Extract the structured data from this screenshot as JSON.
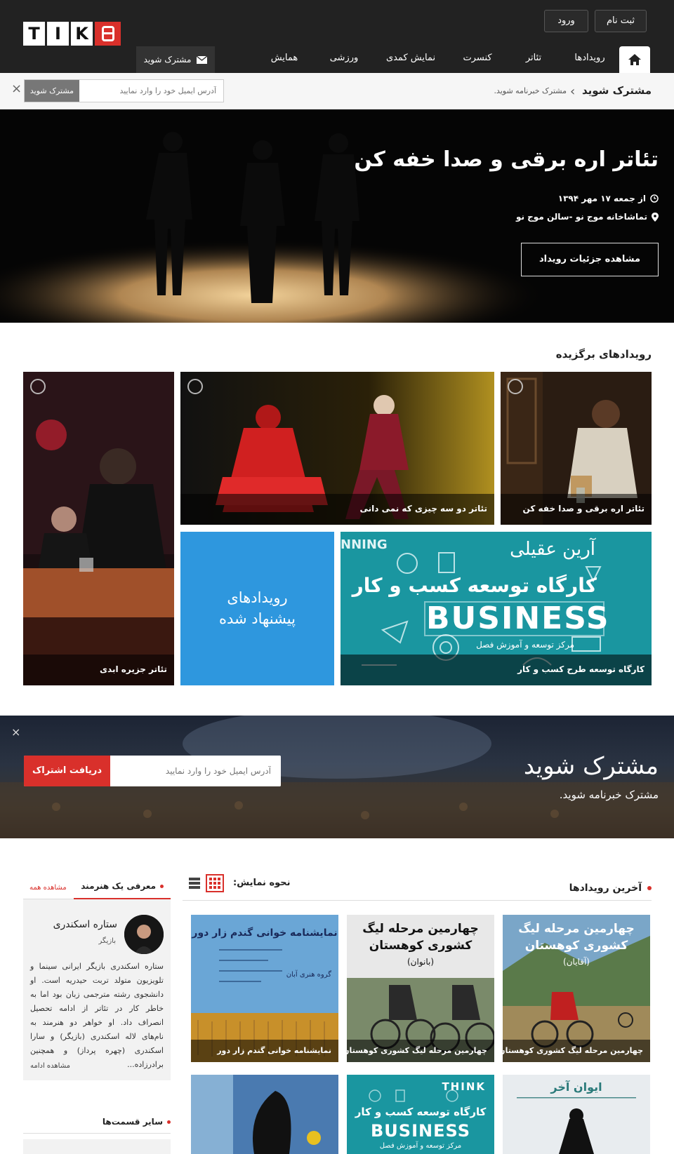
{
  "header": {
    "logo_letters": [
      "T",
      "I",
      "K"
    ],
    "register_label": "ثبت نام",
    "login_label": "ورود",
    "nav_items": [
      "رویدادها",
      "تئاتر",
      "کنسرت",
      "نمایش کمدی",
      "ورزشی",
      "همایش"
    ],
    "subscribe_tab": "مشترک شوید"
  },
  "subscribe_bar": {
    "title": "مشترک شوید",
    "subtitle": "مشترک خبرنامه شوید.",
    "placeholder": "آدرس ایمیل خود را وارد نمایید",
    "button": "مشترک شوید",
    "close": "×"
  },
  "hero": {
    "title": "تئاتر اره برقی و صدا خفه کن",
    "date": "از جمعه ۱۷ مهر ۱۳۹۴",
    "venue": "تماشاخانه موج نو -سالن موج نو",
    "details_button": "مشاهده جزئیات رویداد"
  },
  "featured": {
    "title": "رویدادهای برگزیده",
    "tiles": [
      {
        "caption": "تئاتر اره برقی و صدا خفه کن"
      },
      {
        "caption": "تئاتر دو سه چیزی که نمی دانی"
      },
      {
        "caption": "تئاتر جزیره ابدی"
      },
      {
        "caption": "کارگاه توسعه طرح کسب و کار"
      }
    ],
    "suggested_line1": "رویدادهای",
    "suggested_line2": "پیشنهاد شده",
    "business_text": {
      "name": "آرین عقیلی",
      "workshop": "کارگاه توسعه کسب و کار",
      "word": "BUSINESS",
      "center": "مرکز توسعه و آموزش فصل",
      "corner": "NNING"
    }
  },
  "newsletter": {
    "title": "مشترک شوید",
    "subtitle": "مشترک خبرنامه شوید.",
    "placeholder": "آدرس ایمیل خود را وارد نمایید",
    "button": "دریافت اشتراک",
    "close": "×"
  },
  "latest": {
    "title": "آخرین رویدادها",
    "view_mode_label": "نحوه نمایش:",
    "cards": [
      {
        "caption": "چهارمین مرحله لیگ کشوری کوهستان-آقایان",
        "poster_title": "چهارمین مرحله لیگ کشوری کوهستان",
        "poster_sub": "(آقایان)"
      },
      {
        "caption": "چهارمین مرحله لیگ کشوری کوهستان-بانوان",
        "poster_title": "چهارمین مرحله لیگ کشوری کوهستان",
        "poster_sub": "(بانوان)"
      },
      {
        "caption": "نمایشنامه خوانی گندم زار دور",
        "poster_title": "نمایشنامه خوانی گندم زار دور",
        "poster_sub": "گروه هنری آبان"
      }
    ],
    "second_row": {
      "poster_title": "ایوان آخر",
      "think": "THINK",
      "workshop": "کارگاه توسعه کسب و کار",
      "word": "BUSINESS",
      "center": "مرکز توسعه و آموزش فصل"
    }
  },
  "artist": {
    "tab_label": "معرفی یک هنرمند",
    "view_all": "مشاهده همه",
    "name": "ستاره اسکندری",
    "role": "بازیگر",
    "bio": "ستاره اسکندری بازیگر ایرانی سینما و تلویزیون متولد تربت حیدریه است. او دانشجوی رشته مترجمی زبان بود اما به خاطر کار در تئاتر از ادامه تحصیل انصراف داد. او خواهر دو هنرمند به نام‌های لاله اسکندری (بازیگر) و سارا اسکندری (چهره پرداز) و همچنین برادرزاده...",
    "read_more": "مشاهده ادامه"
  },
  "other_sections": {
    "title": "سایر قسمت‌ها"
  },
  "colors": {
    "accent": "#d9302b",
    "dark": "#222222",
    "blue": "#2e97de",
    "teal": "#17929c"
  }
}
